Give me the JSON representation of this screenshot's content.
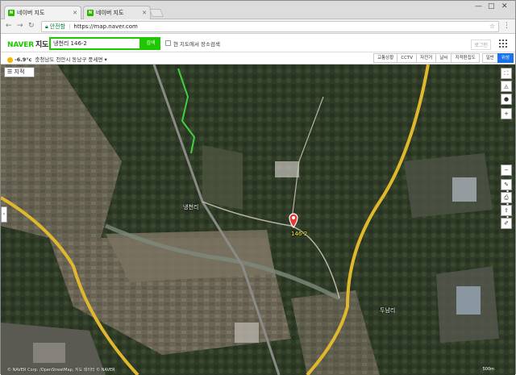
{
  "browser": {
    "tabs": [
      {
        "title": "네이버 지도",
        "active": true
      },
      {
        "title": "네이버 지도",
        "active": false
      }
    ],
    "window_controls": [
      "—",
      "□",
      "✕"
    ],
    "address": {
      "secure_label": "안전함",
      "url": "https://map.naver.com"
    }
  },
  "naver": {
    "logo_naver": "NAVER",
    "logo_map": "지도",
    "search_value": "냉천리 146-2",
    "search_button": "검색",
    "checkbox_label": "현 지도에서 장소검색",
    "checkbox_checked": false,
    "header_right": "로그인"
  },
  "weather": {
    "temp": "-6.9°c",
    "location": "충청남도 천안시 동남구 풍세면",
    "dropdown": "▾"
  },
  "map_tools": [
    "교통상황",
    "CCTV",
    "자전거",
    "날씨",
    "지적편집도"
  ],
  "map_types": [
    {
      "label": "일반",
      "active": false
    },
    {
      "label": "위성",
      "active": true
    }
  ],
  "map": {
    "labels": {
      "place_center": "냉천리",
      "place_right": "두남리",
      "marker_label": "146-2"
    },
    "copyright": "© NAVER Corp. /OpenStreetMap, 지도 데이터 © NAVER",
    "scale": "500m",
    "layer_button": "☰ 지적"
  },
  "colors": {
    "naver_green": "#1ec800",
    "active_blue": "#1a73e8",
    "road_yellow": "#e0b82e",
    "marker_red": "#e53935"
  }
}
